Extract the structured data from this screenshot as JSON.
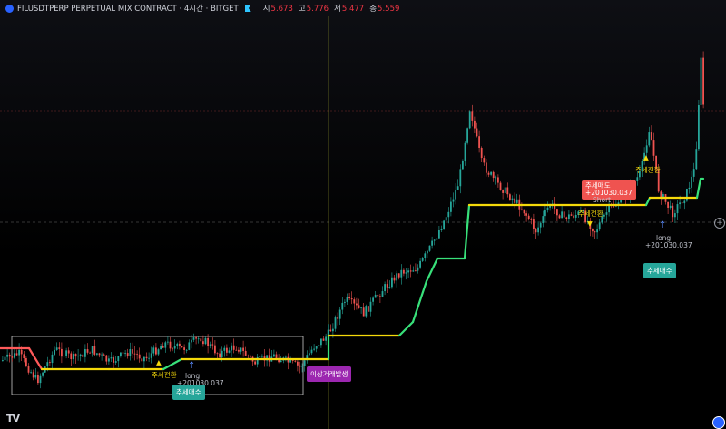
{
  "header": {
    "symbol_title": "FILUSDTPERP PERPETUAL MIX CONTRACT · 4시간 · BITGET",
    "ohlc": [
      {
        "key": "시",
        "value": "5.673"
      },
      {
        "key": "고",
        "value": "5.776"
      },
      {
        "key": "저",
        "value": "5.477"
      },
      {
        "key": "종",
        "value": "5.559"
      }
    ]
  },
  "annotations": {
    "trend_change_1": "주세전환",
    "trend_change_2": "주세전환",
    "trend_change_3": "주세전환",
    "long_label_1": "long",
    "long_label_2": "long",
    "long_value_2": "+201030.037",
    "buy_badge_1_top": "+201030.037",
    "buy_badge_1": "추세매수",
    "buy_badge_2": "추세매수",
    "sell_badge_top": "추세매도",
    "sell_badge_value": "+201030.037",
    "short_label": "Short",
    "anomaly_badge": "이상거래발생"
  },
  "colors": {
    "up": "#26a69a",
    "down": "#ef5350",
    "trend_up": "#38e07a",
    "trend_neutral": "#f5d90a",
    "trend_down": "#ff5a5a",
    "sell_badge": "#ef5350",
    "buy_badge": "#26a69a",
    "anomaly_badge": "#9c27b0"
  },
  "icons": {
    "logo": "tradingview-logo-icon",
    "crosshair": "crosshair-icon"
  }
}
